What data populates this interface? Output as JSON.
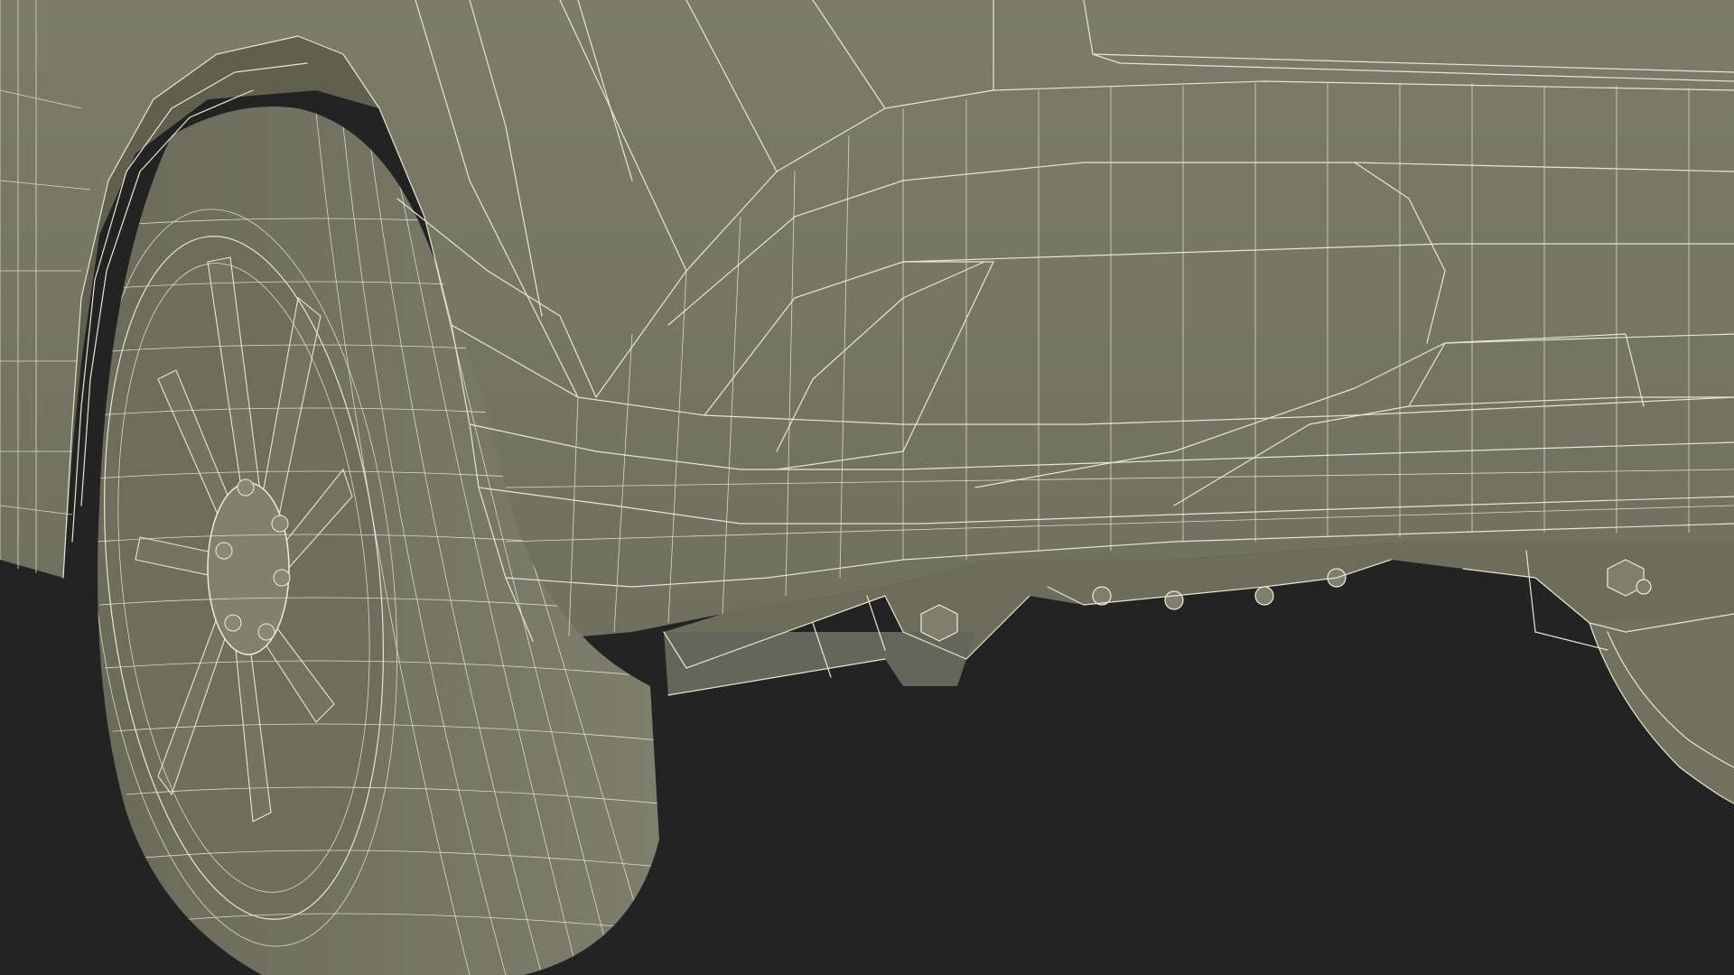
{
  "scene": {
    "background_color": "#232323",
    "mesh_fill_color": "#7a7b6b",
    "mesh_shadow_color": "#5f604f",
    "wire_color": "#e8e6cc"
  }
}
